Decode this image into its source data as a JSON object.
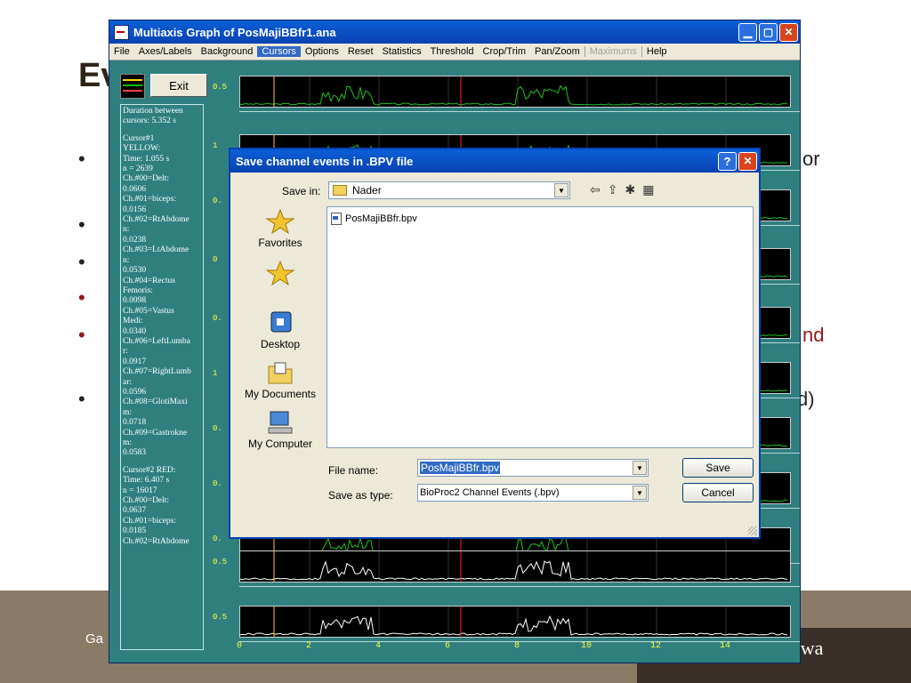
{
  "slide": {
    "title_fragment": "Ev",
    "bullet_char": "•",
    "frag_or": "or",
    "frag_nd": "nd",
    "frag_paren": "d)",
    "footer_left": "Ga",
    "footer_right": "awa"
  },
  "window": {
    "title": "Multiaxis Graph of PosMajiBBfr1.ana",
    "menu": [
      "File",
      "Axes/Labels",
      "Background",
      "Cursors",
      "Options",
      "Reset",
      "Statistics",
      "Threshold",
      "Crop/Trim",
      "Pan/Zoom",
      "Maximums",
      "Help"
    ],
    "active_menu": "Cursors",
    "disabled_menu": "Maximums",
    "exit_label": "Exit",
    "info_lines": [
      "Duration between",
      "cursors: 5.352 s",
      "",
      "Cursor#1",
      "YELLOW:",
      "Time: 1.055 s",
      "   n = 2639",
      "Ch.#00=Delt:",
      "0.0606",
      "Ch.#01=biceps:",
      "0.0156",
      "Ch.#02=RtAbdome",
      "n:",
      "0.0238",
      "Ch.#03=LtAbdome",
      "n:",
      "0.0530",
      "Ch.#04=Rectus",
      "Femoris:",
      "0.0098",
      "Ch.#05=Vastus",
      "Medi:",
      "0.0340",
      "Ch.#06=LeftLumba",
      "r:",
      "0.0917",
      "Ch.#07=RightLumb",
      "ar:",
      "0.0596",
      "Ch.#08=GlotiMaxi",
      "m:",
      "0.0718",
      "Ch.#09=Gastrokne",
      "m:",
      "0.0583",
      "",
      "Cursor#2  RED:",
      "Time: 6.407 s",
      "   n = 16017",
      "Ch.#00=Delt:",
      "   0.0637",
      "Ch.#01=biceps:",
      "   0.0185",
      "Ch.#02=RtAbdome"
    ],
    "channel_ylabels": [
      "0.5",
      "1",
      "0.",
      "0",
      "0.",
      "1",
      "0.",
      "0.",
      "0.",
      "0.5",
      "0.5"
    ],
    "x_ticks": [
      "0",
      "2",
      "4",
      "6",
      "8",
      "10",
      "12",
      "14"
    ]
  },
  "dialog": {
    "title": "Save channel events in .BPV file",
    "help_glyph": "?",
    "close_glyph": "✕",
    "save_in_label": "Save in:",
    "save_in_value": "Nader",
    "places": [
      "Favorites",
      "",
      "Desktop",
      "My Documents",
      "My Computer"
    ],
    "files": [
      "PosMajiBBfr.bpv"
    ],
    "file_name_label": "File name:",
    "file_name_value": "PosMajiBBfr.bpv",
    "save_as_type_label": "Save as type:",
    "save_as_type_value": "BioProc2 Channel Events (.bpv)",
    "save_button": "Save",
    "cancel_button": "Cancel"
  },
  "colors": {
    "teal": "#2f7f7f",
    "xp_blue": "#0842b0",
    "cursor_yellow": "#ffd000",
    "cursor_red": "#ff2020",
    "trace_green": "#20c020"
  }
}
